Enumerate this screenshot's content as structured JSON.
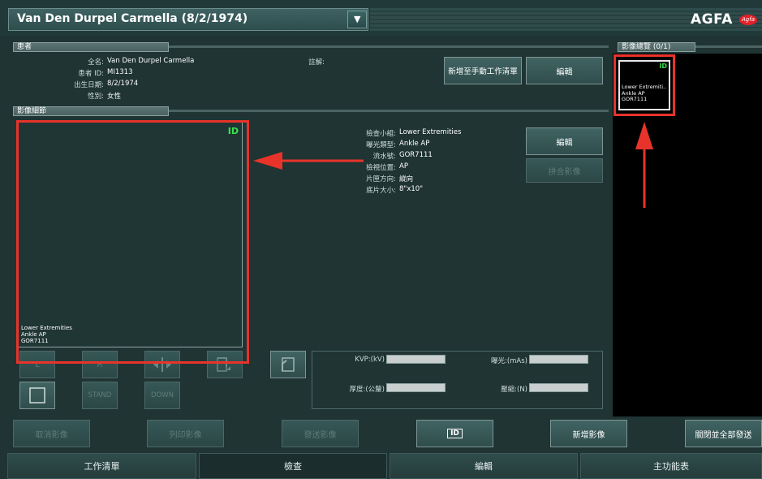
{
  "header": {
    "patient_title": "Van Den Durpel Carmella (8/2/1974)",
    "dropdown_glyph": "▼",
    "brand": "AGFA",
    "brand_mark": "Agfa"
  },
  "patient": {
    "section_title": "患者",
    "fullname_label": "全名:",
    "fullname": "Van Den Durpel Carmella",
    "id_label": "患者 ID:",
    "id": "MI1313",
    "dob_label": "出生日期:",
    "dob": "8/2/1974",
    "sex_label": "性別:",
    "sex": "女性",
    "comment_label": "註解:",
    "add_worklist_button": "新增至手動工作清單",
    "edit_button": "編輯"
  },
  "image_detail": {
    "section_title": "影像細節",
    "preview_id": "ID",
    "preview_lines": [
      "Lower Extremities",
      "Ankle AP",
      "GOR7111"
    ],
    "fields": [
      {
        "label": "檢查小組:",
        "value": "Lower Extremities"
      },
      {
        "label": "曝光類型:",
        "value": "Ankle AP"
      },
      {
        "label": "流水號:",
        "value": "GOR7111"
      },
      {
        "label": "檢視位置:",
        "value": "AP"
      },
      {
        "label": "片匣方向:",
        "value": "縱向"
      },
      {
        "label": "底片大小:",
        "value": "8\"x10\""
      }
    ],
    "edit_button": "編輯",
    "merge_button": "拼合影像",
    "ctrl_l": "L",
    "ctrl_r": "R",
    "ctrl_stand": "STAND",
    "ctrl_down": "DOWN"
  },
  "exposure": {
    "kvp_label": "KVP:(kV)",
    "mas_label": "曝光:(mAs)",
    "thickness_label": "厚度:(公釐)",
    "compression_label": "壓縮:(N)"
  },
  "overview": {
    "section_title": "影像總覽 (0/1)",
    "thumb_id": "ID",
    "thumb_lines": [
      "Lower Extremiti..",
      "Ankle AP",
      "GOR7111"
    ]
  },
  "actions": {
    "cancel_image": "取消影像",
    "print_image": "列印影像",
    "send_image": "發送影像",
    "id_button": "ID",
    "add_image": "新增影像",
    "close_send_all": "關閉並全部發送"
  },
  "nav_tabs": [
    "工作清單",
    "檢查",
    "編輯",
    "主功能表"
  ],
  "colors": {
    "annotation_red": "#e8332a",
    "id_green": "#38e24c",
    "background": "#1f3433"
  }
}
